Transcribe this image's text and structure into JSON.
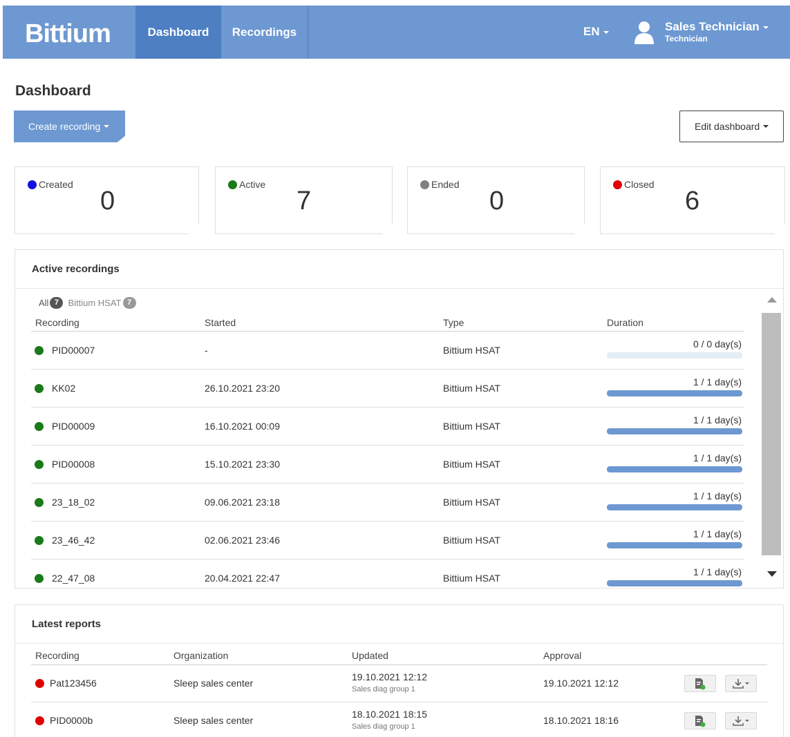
{
  "app": {
    "logo": "Bittium",
    "nav": [
      {
        "label": "Dashboard"
      },
      {
        "label": "Recordings"
      }
    ],
    "language": "EN",
    "user": {
      "name": "Sales Technician",
      "role": "Technician",
      "icon": "user-icon"
    }
  },
  "page": {
    "title": "Dashboard",
    "create_label": "Create recording",
    "edit_label": "Edit dashboard"
  },
  "colors": {
    "accent": "#6d98d2",
    "active_nav": "#4d7fc2",
    "created": "#1010e0",
    "active": "#1a7a1a",
    "ended": "#808080",
    "closed": "#e00000"
  },
  "status_cards": [
    {
      "label": "Created",
      "value": "0",
      "color": "#1010e0"
    },
    {
      "label": "Active",
      "value": "7",
      "color": "#1a7a1a"
    },
    {
      "label": "Ended",
      "value": "0",
      "color": "#808080"
    },
    {
      "label": "Closed",
      "value": "6",
      "color": "#e00000"
    }
  ],
  "active_recordings": {
    "title": "Active recordings",
    "filters": [
      {
        "label": "All",
        "count": "7"
      },
      {
        "label": "Bittium HSAT",
        "count": "7"
      }
    ],
    "columns": [
      "Recording",
      "Started",
      "Type",
      "Duration"
    ],
    "rows": [
      {
        "recording": "PID00007",
        "started": "-",
        "type": "Bittium HSAT",
        "duration": "0 / 0 day(s)",
        "progress": 0
      },
      {
        "recording": "KK02",
        "started": "26.10.2021  23:20",
        "type": "Bittium HSAT",
        "duration": "1 / 1 day(s)",
        "progress": 1
      },
      {
        "recording": "PID00009",
        "started": "16.10.2021  00:09",
        "type": "Bittium HSAT",
        "duration": "1 / 1 day(s)",
        "progress": 1
      },
      {
        "recording": "PID00008",
        "started": "15.10.2021  23:30",
        "type": "Bittium HSAT",
        "duration": "1 / 1 day(s)",
        "progress": 1
      },
      {
        "recording": "23_18_02",
        "started": "09.06.2021  23:18",
        "type": "Bittium HSAT",
        "duration": "1 / 1 day(s)",
        "progress": 1
      },
      {
        "recording": "23_46_42",
        "started": "02.06.2021  23:46",
        "type": "Bittium HSAT",
        "duration": "1 / 1 day(s)",
        "progress": 1
      },
      {
        "recording": "22_47_08",
        "started": "20.04.2021  22:47",
        "type": "Bittium HSAT",
        "duration": "1 / 1 day(s)",
        "progress": 1
      }
    ]
  },
  "latest_reports": {
    "title": "Latest reports",
    "columns": [
      "Recording",
      "Organization",
      "Updated",
      "Approval"
    ],
    "rows": [
      {
        "recording": "Pat123456",
        "organization": "Sleep sales center",
        "updated": "19.10.2021  12:12",
        "group": "Sales diag group 1",
        "approval": "19.10.2021 12:12",
        "report_icon": "report-icon",
        "download_icon": "download-icon"
      },
      {
        "recording": "PID0000b",
        "organization": "Sleep sales center",
        "updated": "18.10.2021  18:15",
        "group": "Sales diag group 1",
        "approval": "18.10.2021 18:16",
        "report_icon": "report-icon",
        "download_icon": "download-icon"
      }
    ]
  }
}
